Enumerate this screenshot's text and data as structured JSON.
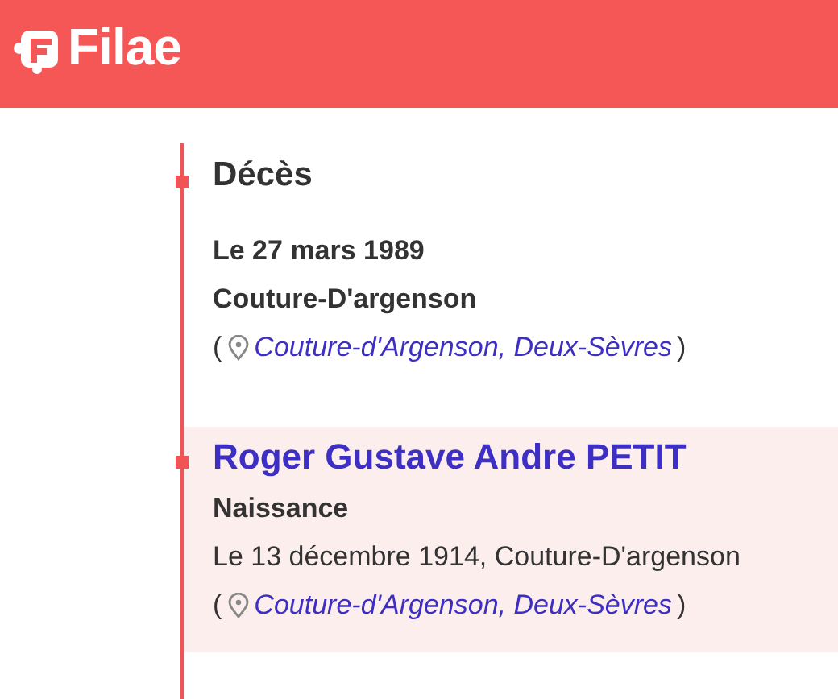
{
  "header": {
    "logo_text": "Filae"
  },
  "entries": [
    {
      "kind": "event",
      "highlighted": false,
      "title": "Décès",
      "lines": [
        {
          "text": "Le 27 mars 1989",
          "bold": true
        },
        {
          "text": "Couture-D'argenson",
          "bold": true
        }
      ],
      "place": {
        "open": "(",
        "link": "Couture-d'Argenson, Deux-Sèvres",
        "close": ")"
      }
    },
    {
      "kind": "person",
      "highlighted": true,
      "title": "Roger Gustave Andre PETIT",
      "lines": [
        {
          "text": "Naissance",
          "bold": true
        },
        {
          "text": "Le 13 décembre 1914, Couture-D'argenson",
          "bold": false
        }
      ],
      "place": {
        "open": "(",
        "link": "Couture-d'Argenson, Deux-Sèvres",
        "close": ")"
      }
    }
  ]
}
